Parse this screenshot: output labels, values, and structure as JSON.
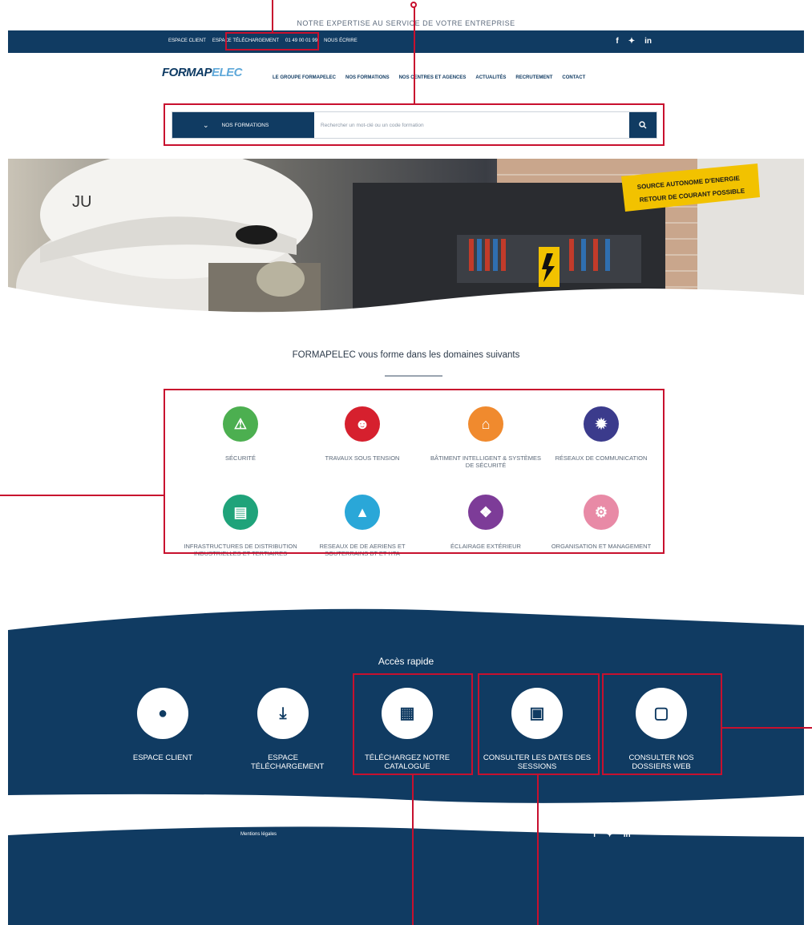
{
  "topline": "NOTRE EXPERTISE AU SERVICE DE VOTRE ENTREPRISE",
  "topbar": {
    "links": [
      "ESPACE CLIENT",
      "ESPACE TÉLÉCHARGEMENT",
      "01 49 00 01 99",
      "NOUS ÉCRIRE"
    ],
    "social": [
      "f",
      "t",
      "in"
    ]
  },
  "logo": {
    "main": "FORMAP",
    "accent": "ELEC"
  },
  "nav": [
    "LE GROUPE FORMAPELEC",
    "NOS FORMATIONS",
    "NOS CENTRES ET AGENCES",
    "ACTUALITÉS",
    "RECRUTEMENT",
    "CONTACT"
  ],
  "search": {
    "dropdown_label": "NOS FORMATIONS",
    "placeholder": "Rechercher un mot-clé ou un code formation",
    "button_icon": "search-icon"
  },
  "hero": {
    "sign_line1": "SOURCE AUTONOME D'ENERGIE",
    "sign_line2": "RETOUR DE COURANT POSSIBLE",
    "helmet_text": "JU"
  },
  "domains": {
    "title": "FORMAPELEC vous forme dans les domaines suivants",
    "items": [
      {
        "label": "SÉCURITÉ",
        "color": "#4caf50",
        "icon": "warning-triangle-icon"
      },
      {
        "label": "TRAVAUX SOUS TENSION",
        "color": "#d6202e",
        "icon": "worker-icon"
      },
      {
        "label": "BÂTIMENT INTELLIGENT & SYSTÈMES DE SÉCURITÉ",
        "color": "#f08a2e",
        "icon": "smart-building-icon"
      },
      {
        "label": "RÉSEAUX DE COMMUNICATION",
        "color": "#3b3b8c",
        "icon": "fiber-optic-icon"
      },
      {
        "label": "INFRASTRUCTURES DE DISTRIBUTION INDUSTRIELLES ET TERTIAIRES",
        "color": "#1fa37a",
        "icon": "factory-icon"
      },
      {
        "label": "RESEAUX DE DE AERIENS ET SOUTERRAINS BT ET HTA",
        "color": "#2aa7d8",
        "icon": "pylon-icon"
      },
      {
        "label": "ÉCLAIRAGE EXTÉRIEUR",
        "color": "#7d3c98",
        "icon": "road-light-icon"
      },
      {
        "label": "ORGANISATION ET MANAGEMENT",
        "color": "#e88aa6",
        "icon": "organisation-icon"
      }
    ]
  },
  "quick": {
    "title": "Accès rapide",
    "items": [
      {
        "label": "ESPACE CLIENT",
        "icon": "user-icon"
      },
      {
        "label": "ESPACE TÉLÉCHARGEMENT",
        "icon": "download-icon"
      },
      {
        "label": "TÉLÉCHARGEZ NOTRE CATALOGUE",
        "icon": "catalogue-icon"
      },
      {
        "label": "CONSULTER LES DATES DES SESSIONS",
        "icon": "calendar-icon"
      },
      {
        "label": "CONSULTER NOS DOSSIERS WEB",
        "icon": "laptop-icon"
      }
    ]
  },
  "footer": {
    "legal": "Mentions légales",
    "social": [
      "f",
      "t",
      "in"
    ]
  },
  "colors": {
    "navy": "#103b62",
    "annotation": "#c8102e"
  }
}
